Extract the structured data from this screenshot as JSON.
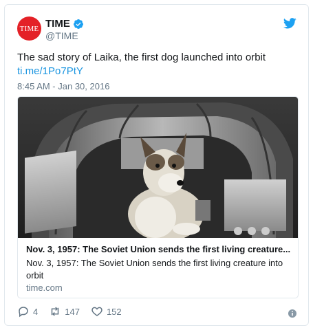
{
  "account": {
    "avatar_text": "TIME",
    "display_name": "TIME",
    "handle": "@TIME",
    "verified": true
  },
  "tweet": {
    "text": "The sad story of Laika, the first dog launched into orbit",
    "link": "ti.me/1Po7PtY",
    "timestamp": "8:45 AM - Jan 30, 2016"
  },
  "card": {
    "title": "Nov. 3, 1957: The Soviet Union sends the first living creature...",
    "description": "Nov. 3, 1957: The Soviet Union sends the first living creature into orbit",
    "domain": "time.com"
  },
  "actions": {
    "replies": "4",
    "retweets": "147",
    "likes": "152"
  },
  "colors": {
    "brand_red": "#e42127",
    "twitter_blue": "#1da1f2",
    "link_blue": "#1b95e0",
    "muted": "#657786"
  },
  "icons": [
    "time-avatar",
    "verified-badge-icon",
    "twitter-bird-icon",
    "reply-icon",
    "retweet-icon",
    "like-icon",
    "info-icon"
  ]
}
